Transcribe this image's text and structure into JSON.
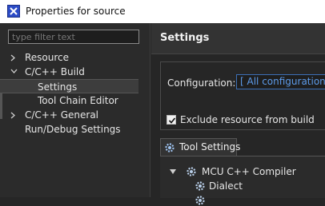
{
  "window": {
    "title": "Properties for source",
    "icon": "eclipse-x-icon"
  },
  "filter": {
    "placeholder": "type filter text",
    "value": ""
  },
  "tree": {
    "items": [
      {
        "label": "Resource",
        "expander": "collapsed",
        "level": 0,
        "selected": false
      },
      {
        "label": "C/C++ Build",
        "expander": "expanded",
        "level": 0,
        "selected": false
      },
      {
        "label": "Settings",
        "expander": "none",
        "level": 1,
        "selected": true
      },
      {
        "label": "Tool Chain Editor",
        "expander": "none",
        "level": 1,
        "selected": false
      },
      {
        "label": "C/C++ General",
        "expander": "collapsed",
        "level": 0,
        "selected": false
      },
      {
        "label": "Run/Debug Settings",
        "expander": "none",
        "level": 0,
        "selected": false
      }
    ]
  },
  "settings": {
    "title": "Settings",
    "configuration_label": "Configuration:",
    "configuration_value": "[ All configurations ]",
    "exclude_label": "Exclude resource from build",
    "exclude_checked": true
  },
  "tool_settings": {
    "tab_label": "Tool Settings",
    "compiler_label": "MCU C++ Compiler",
    "dialect_label": "Dialect"
  },
  "colors": {
    "link_blue": "#5d9bea",
    "selection_bg": "#3d3d3d",
    "header_bg": "#333333"
  }
}
